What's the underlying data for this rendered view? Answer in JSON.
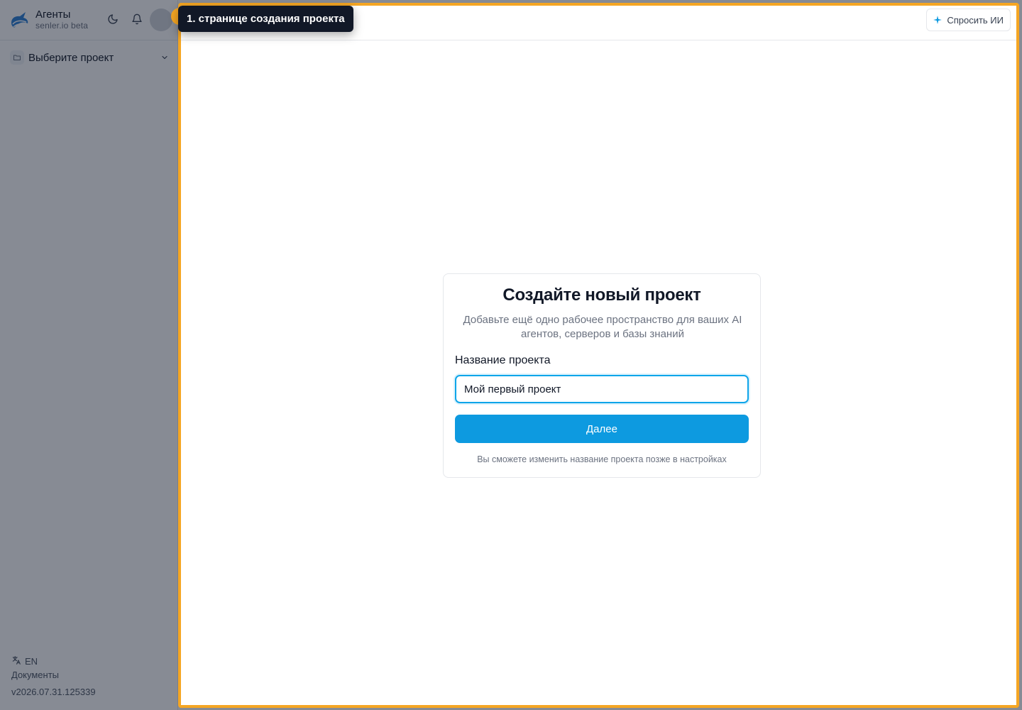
{
  "sidebar": {
    "brand_title": "Агенты",
    "brand_subtitle": "senler.io beta",
    "project_selector_label": "Выберите проект",
    "language_label": "EN",
    "docs_label": "Документы",
    "version": "v2026.07.31.125339"
  },
  "header": {
    "ask_ai_label": "Спросить ИИ"
  },
  "card": {
    "title": "Создайте новый проект",
    "subtitle": "Добавьте ещё одно рабочее пространство для ваших AI агентов, серверов и базы знаний",
    "field_label": "Название проекта",
    "input_value": "Мой первый проект",
    "next_button_label": "Далее",
    "hint": "Вы сможете изменить название проекта позже в настройках"
  },
  "tour": {
    "tooltip_text": "1. странице создания проекта"
  },
  "colors": {
    "accent": "#0d9ae0",
    "tour_highlight": "#f5a623",
    "tooltip_bg": "#111827"
  }
}
